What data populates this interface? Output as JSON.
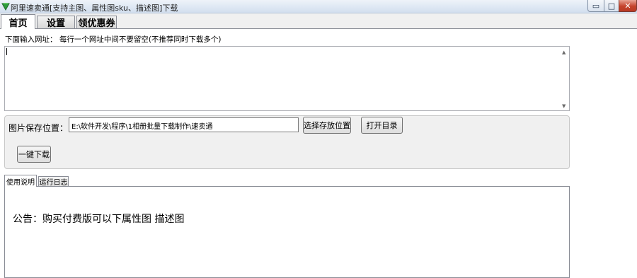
{
  "window": {
    "title": "阿里速卖通[支持主图、属性图sku、描述图]下载",
    "minimize_glyph": "▭",
    "maximize_glyph": "□",
    "close_glyph": "✕"
  },
  "top_tabs": [
    {
      "label": "首页",
      "active": true
    },
    {
      "label": "设置",
      "active": false
    },
    {
      "label": "领优惠券",
      "active": false
    }
  ],
  "home": {
    "url_label": "下面输入网址： 每行一个网址中间不要留空(不推荐同时下载多个)",
    "url_value": "",
    "save_label": "图片保存位置：",
    "save_path": "E:\\软件开发\\程序\\1相册批量下载制作\\速卖通",
    "choose_location_button": "选择存放位置",
    "open_folder_button": "打开目录",
    "download_button": "一键下载"
  },
  "lower_tabs": [
    {
      "label": "使用说明",
      "active": true
    },
    {
      "label": "运行日志",
      "active": false
    }
  ],
  "notice": {
    "text": "公告：购买付费版可以下属性图 描述图"
  },
  "colors": {
    "titlebar": "#dde7f3",
    "close_button": "#c4432c",
    "panel_bg": "#f0f0f0",
    "border": "#898c95"
  }
}
